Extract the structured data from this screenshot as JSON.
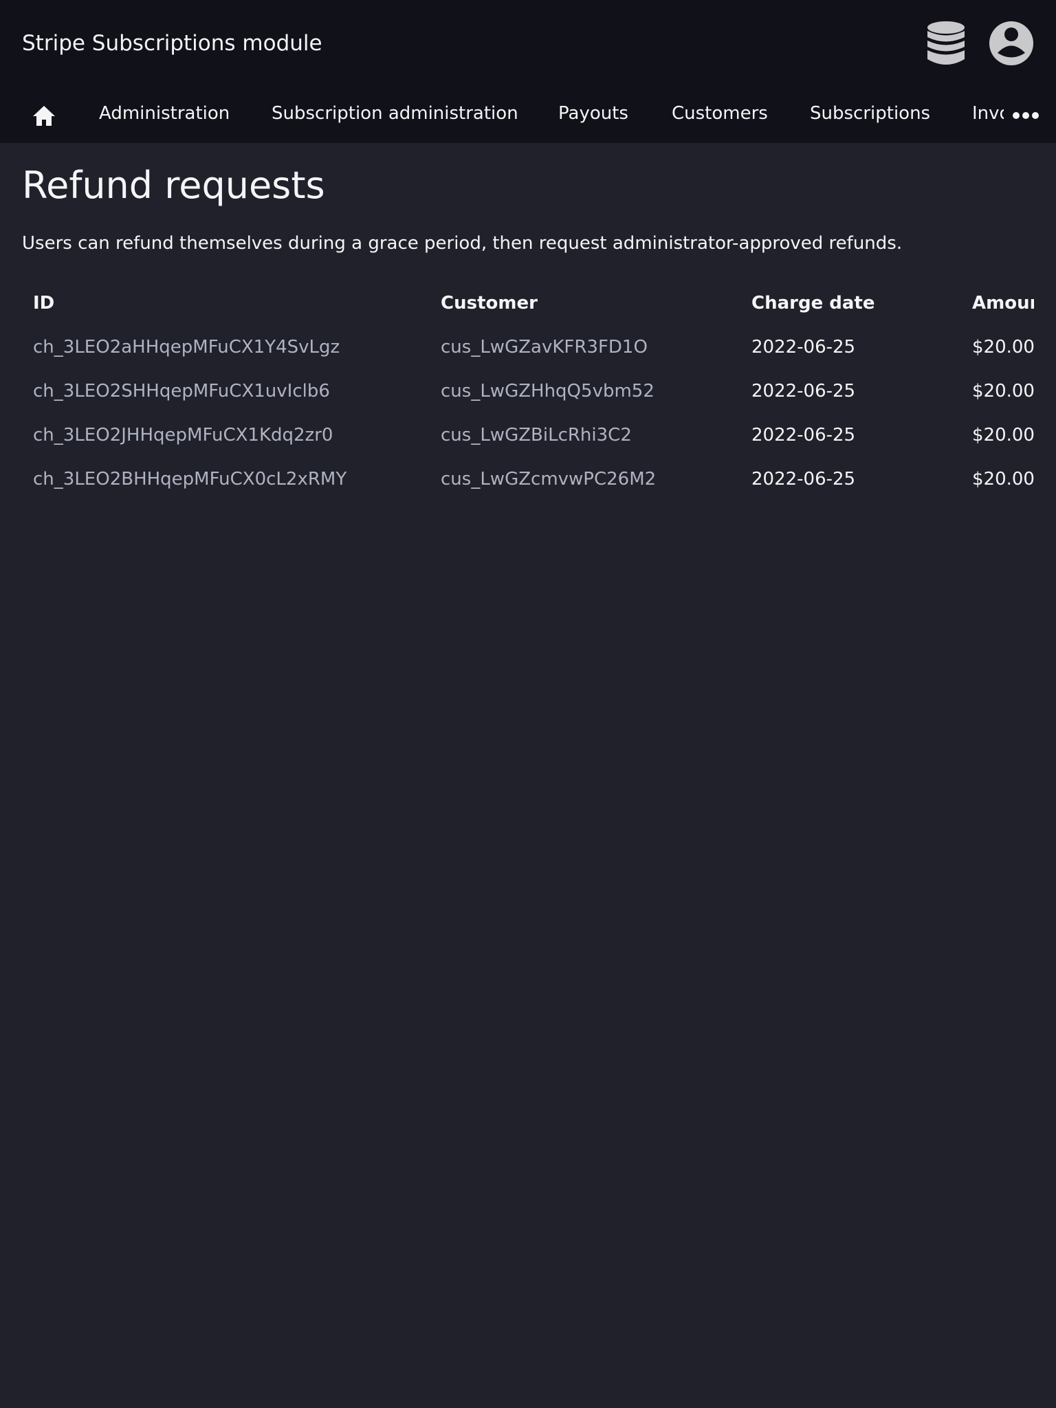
{
  "header": {
    "app_title": "Stripe Subscriptions module",
    "icons": [
      "database-icon",
      "user-account-icon"
    ]
  },
  "nav": {
    "home_icon": "home-icon",
    "items": [
      {
        "label": "Administration"
      },
      {
        "label": "Subscription administration"
      },
      {
        "label": "Payouts"
      },
      {
        "label": "Customers"
      },
      {
        "label": "Subscriptions"
      },
      {
        "label": "Invoices"
      }
    ],
    "more_icon": "more-horizontal-icon"
  },
  "page": {
    "title": "Refund requests",
    "description": "Users can refund themselves during a grace period, then request administrator-approved refunds."
  },
  "table": {
    "headers": [
      "ID",
      "Customer",
      "Charge date",
      "Amount"
    ],
    "rows": [
      {
        "id": "ch_3LEO2aHHqepMFuCX1Y4SvLgz",
        "customer": "cus_LwGZavKFR3FD1O",
        "charge_date": "2022-06-25",
        "amount": "$20.00"
      },
      {
        "id": "ch_3LEO2SHHqepMFuCX1uvIclb6",
        "customer": "cus_LwGZHhqQ5vbm52",
        "charge_date": "2022-06-25",
        "amount": "$20.00"
      },
      {
        "id": "ch_3LEO2JHHqepMFuCX1Kdq2zr0",
        "customer": "cus_LwGZBiLcRhi3C2",
        "charge_date": "2022-06-25",
        "amount": "$20.00"
      },
      {
        "id": "ch_3LEO2BHHqepMFuCX0cL2xRMY",
        "customer": "cus_LwGZcmvwPC26M2",
        "charge_date": "2022-06-25",
        "amount": "$20.00"
      }
    ]
  },
  "colors": {
    "header_bg": "#11111a",
    "page_bg": "#21212b",
    "text": "#f5f5f7",
    "link_text": "#aeb3c2",
    "icon_fill": "#c9c9cc"
  }
}
